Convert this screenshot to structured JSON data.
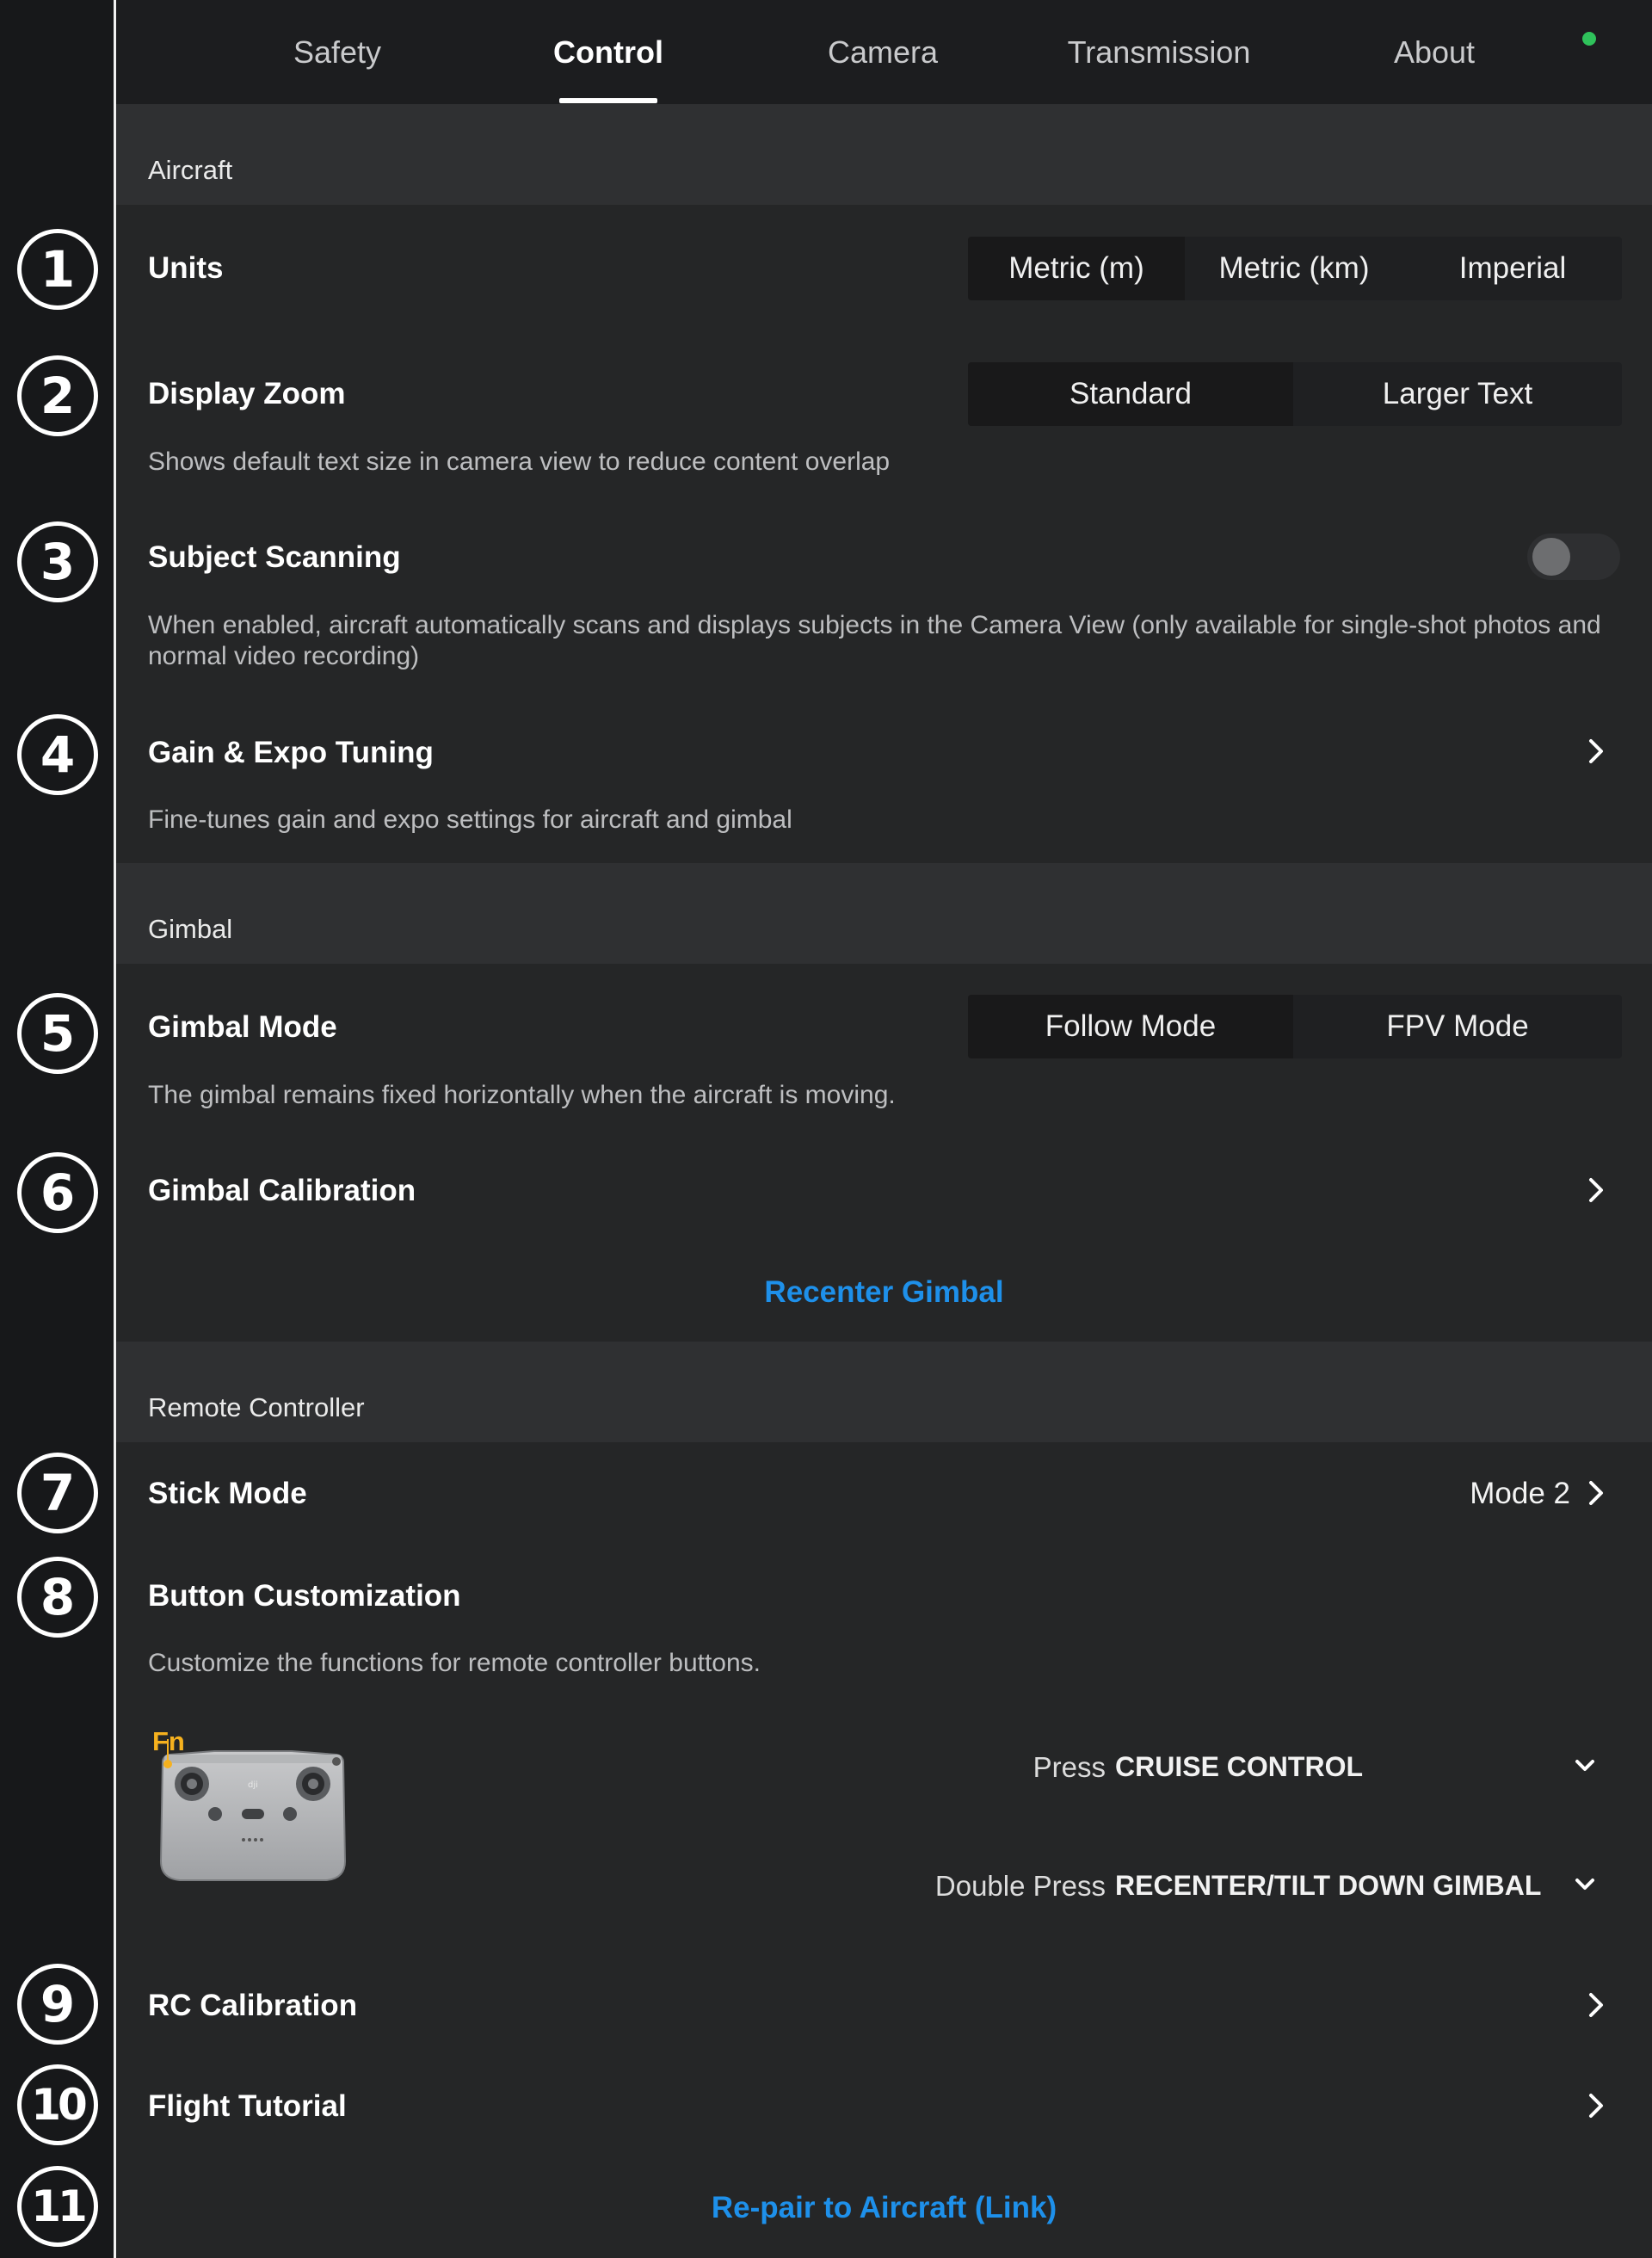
{
  "tabs": [
    {
      "label": "Safety"
    },
    {
      "label": "Control",
      "active": true
    },
    {
      "label": "Camera"
    },
    {
      "label": "Transmission"
    },
    {
      "label": "About"
    }
  ],
  "status_dot_color": "#2fc25b",
  "accent_color": "#1e90ea",
  "markers": [
    "1",
    "2",
    "3",
    "4",
    "5",
    "6",
    "7",
    "8",
    "9",
    "10",
    "11"
  ],
  "aircraft": {
    "header": "Aircraft",
    "units": {
      "title": "Units",
      "options": [
        "Metric (m)",
        "Metric (km)",
        "Imperial"
      ],
      "selected": "Metric (m)"
    },
    "display_zoom": {
      "title": "Display Zoom",
      "options": [
        "Standard",
        "Larger Text"
      ],
      "selected": "Standard",
      "description": "Shows default text size in camera view to reduce content overlap"
    },
    "subject_scanning": {
      "title": "Subject Scanning",
      "enabled": false,
      "description": "When enabled, aircraft automatically scans and displays subjects in the Camera View (only available for single-shot photos and normal video recording)"
    },
    "gain_expo": {
      "title": "Gain & Expo Tuning",
      "description": "Fine-tunes gain and expo settings for aircraft and gimbal"
    }
  },
  "gimbal": {
    "header": "Gimbal",
    "mode": {
      "title": "Gimbal Mode",
      "options": [
        "Follow Mode",
        "FPV Mode"
      ],
      "selected": "Follow Mode",
      "description": "The gimbal remains fixed horizontally when the aircraft is moving."
    },
    "calibration": {
      "title": "Gimbal Calibration"
    },
    "recenter": "Recenter Gimbal"
  },
  "remote_controller": {
    "header": "Remote Controller",
    "stick_mode": {
      "title": "Stick Mode",
      "value": "Mode 2"
    },
    "button_customization": {
      "title": "Button Customization",
      "description": "Customize the functions for remote controller buttons.",
      "button_label": "Fn",
      "press_label": "Press",
      "press_value": "CRUISE CONTROL",
      "double_press_label": "Double Press",
      "double_press_value": "RECENTER/TILT DOWN GIMBAL"
    },
    "rc_calibration": {
      "title": "RC Calibration"
    },
    "flight_tutorial": {
      "title": "Flight Tutorial"
    },
    "repair": "Re-pair to Aircraft (Link)"
  }
}
